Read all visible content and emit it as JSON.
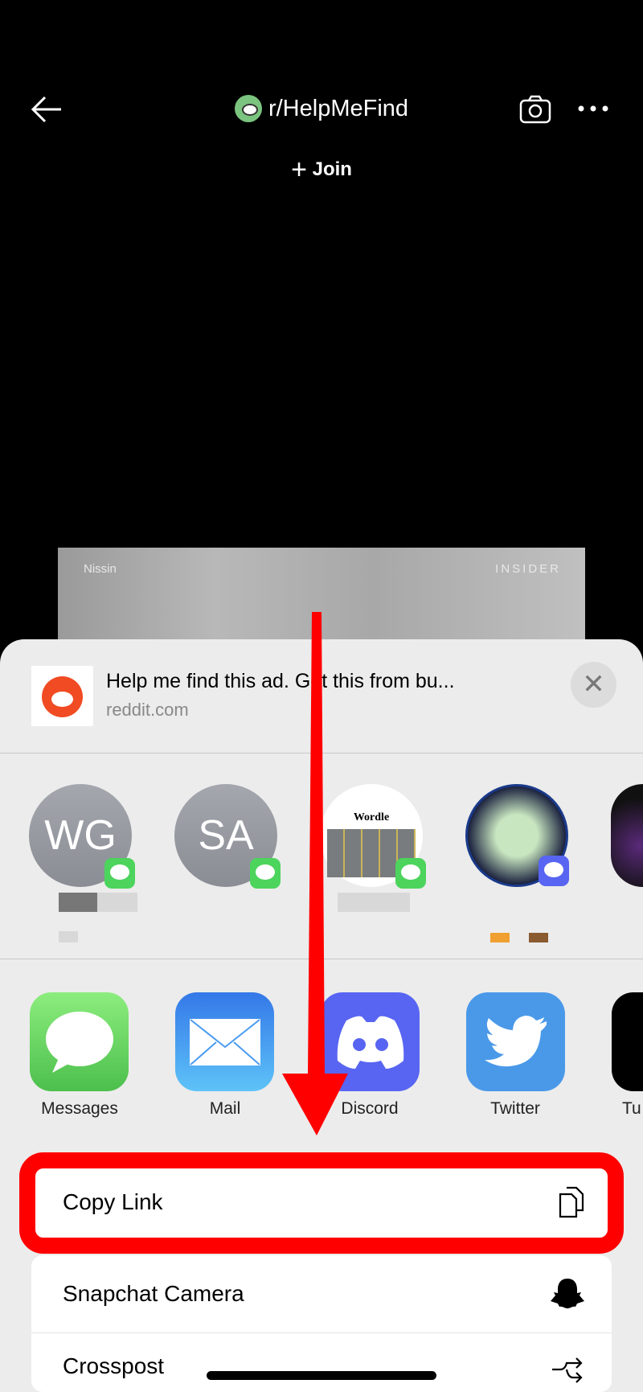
{
  "topbar": {
    "back_icon": "arrow-left-icon",
    "subreddit": "r/HelpMeFind",
    "join_label": "Join",
    "camera_icon": "camera-icon",
    "more_icon": "more-horizontal-icon"
  },
  "video": {
    "left_text": "Nissin",
    "right_text": "INSIDER"
  },
  "share_sheet": {
    "title": "Help me find this ad. Got this from bu...",
    "domain": "reddit.com",
    "close_icon": "close-icon",
    "contacts": [
      {
        "initials": "WG",
        "app": "messages"
      },
      {
        "initials": "SA",
        "app": "messages"
      },
      {
        "initials": "",
        "app": "messages",
        "preview": "Wordle"
      },
      {
        "initials": "",
        "app": "discord"
      },
      {
        "initials": "",
        "app": ""
      }
    ],
    "apps": [
      {
        "label": "Messages",
        "color": "#5ecf5e"
      },
      {
        "label": "Mail",
        "color": "#3d8bf0"
      },
      {
        "label": "Discord",
        "color": "#5865f2"
      },
      {
        "label": "Twitter",
        "color": "#4a99e9"
      },
      {
        "label": "Tu",
        "color": "#000000"
      }
    ],
    "actions": [
      {
        "label": "Copy Link",
        "icon": "copy-icon"
      },
      {
        "label": "Snapchat Camera",
        "icon": "snapchat-ghost-icon"
      },
      {
        "label": "Crosspost",
        "icon": "crosspost-icon"
      }
    ]
  },
  "annotation": {
    "color": "#ff0000"
  }
}
